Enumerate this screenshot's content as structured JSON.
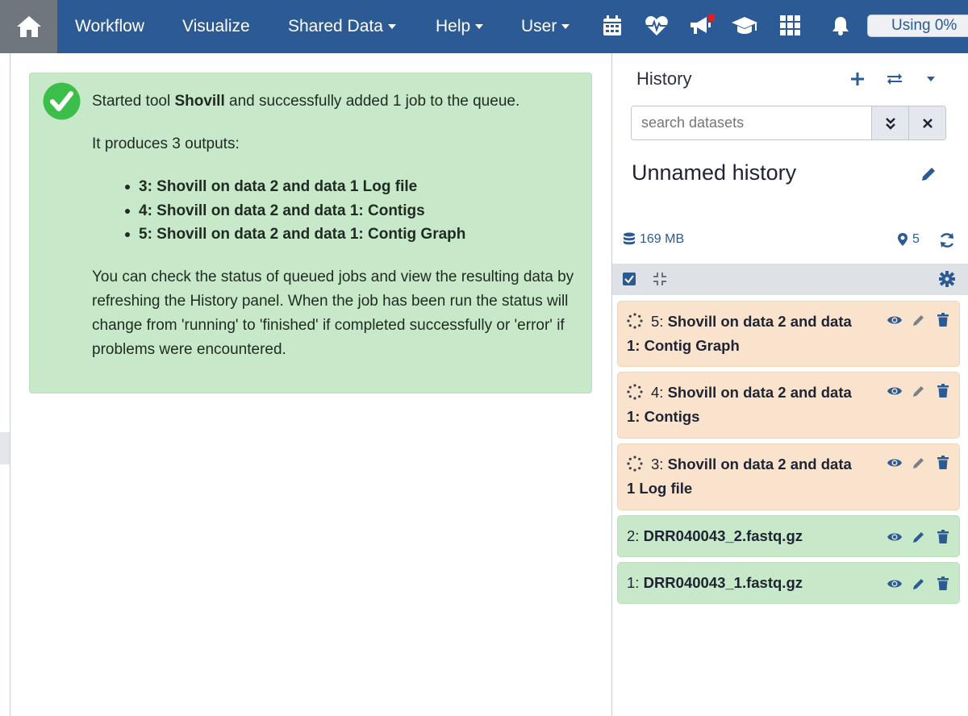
{
  "nav": {
    "home_icon": "home-icon",
    "items": [
      {
        "label": "Workflow",
        "dropdown": false
      },
      {
        "label": "Visualize",
        "dropdown": false
      },
      {
        "label": "Shared Data",
        "dropdown": true
      },
      {
        "label": "Help",
        "dropdown": true
      },
      {
        "label": "User",
        "dropdown": true
      }
    ],
    "icons": [
      "calendar-icon",
      "heartbeat-icon",
      "bullhorn-icon",
      "graduation-cap-icon",
      "apps-grid-icon",
      "bell-icon"
    ],
    "quota_label": "Using 0%",
    "colors": {
      "bar": "#2c5a94",
      "home": "#6f767d",
      "badge": "#e02020"
    }
  },
  "alert": {
    "intro_prefix": "Started tool ",
    "tool_name": "Shovill",
    "intro_suffix": " and successfully added 1 job to the queue.",
    "outputs_heading": "It produces 3 outputs:",
    "outputs": [
      "3: Shovill on data 2 and data 1 Log file",
      "4: Shovill on data 2 and data 1: Contigs",
      "5: Shovill on data 2 and data 1: Contig Graph"
    ],
    "footer": "You can check the status of queued jobs and view the resulting data by refreshing the History panel. When the job has been run the status will change from 'running' to 'finished' if completed successfully or 'error' if problems were encountered.",
    "color": "#c8e9c9"
  },
  "history": {
    "title": "History",
    "search_placeholder": "search datasets",
    "name": "Unnamed history",
    "size": "169 MB",
    "count": "5",
    "datasets": [
      {
        "hid": "5:",
        "name_line1": "Shovill on data 2 and data",
        "name_line2": "1: Contig Graph",
        "state": "queued"
      },
      {
        "hid": "4:",
        "name_line1": "Shovill on data 2 and data",
        "name_line2": "1: Contigs",
        "state": "queued"
      },
      {
        "hid": "3:",
        "name_line1": "Shovill on data 2 and data",
        "name_line2": "1 Log file",
        "state": "queued"
      },
      {
        "hid": "2:",
        "name_line1": "DRR040043_2.fastq.gz",
        "name_line2": "",
        "state": "ok"
      },
      {
        "hid": "1:",
        "name_line1": "DRR040043_1.fastq.gz",
        "name_line2": "",
        "state": "ok"
      }
    ],
    "colors": {
      "queued": "#fae3cd",
      "ok": "#c8e9c9",
      "accent": "#2c5a94"
    }
  }
}
